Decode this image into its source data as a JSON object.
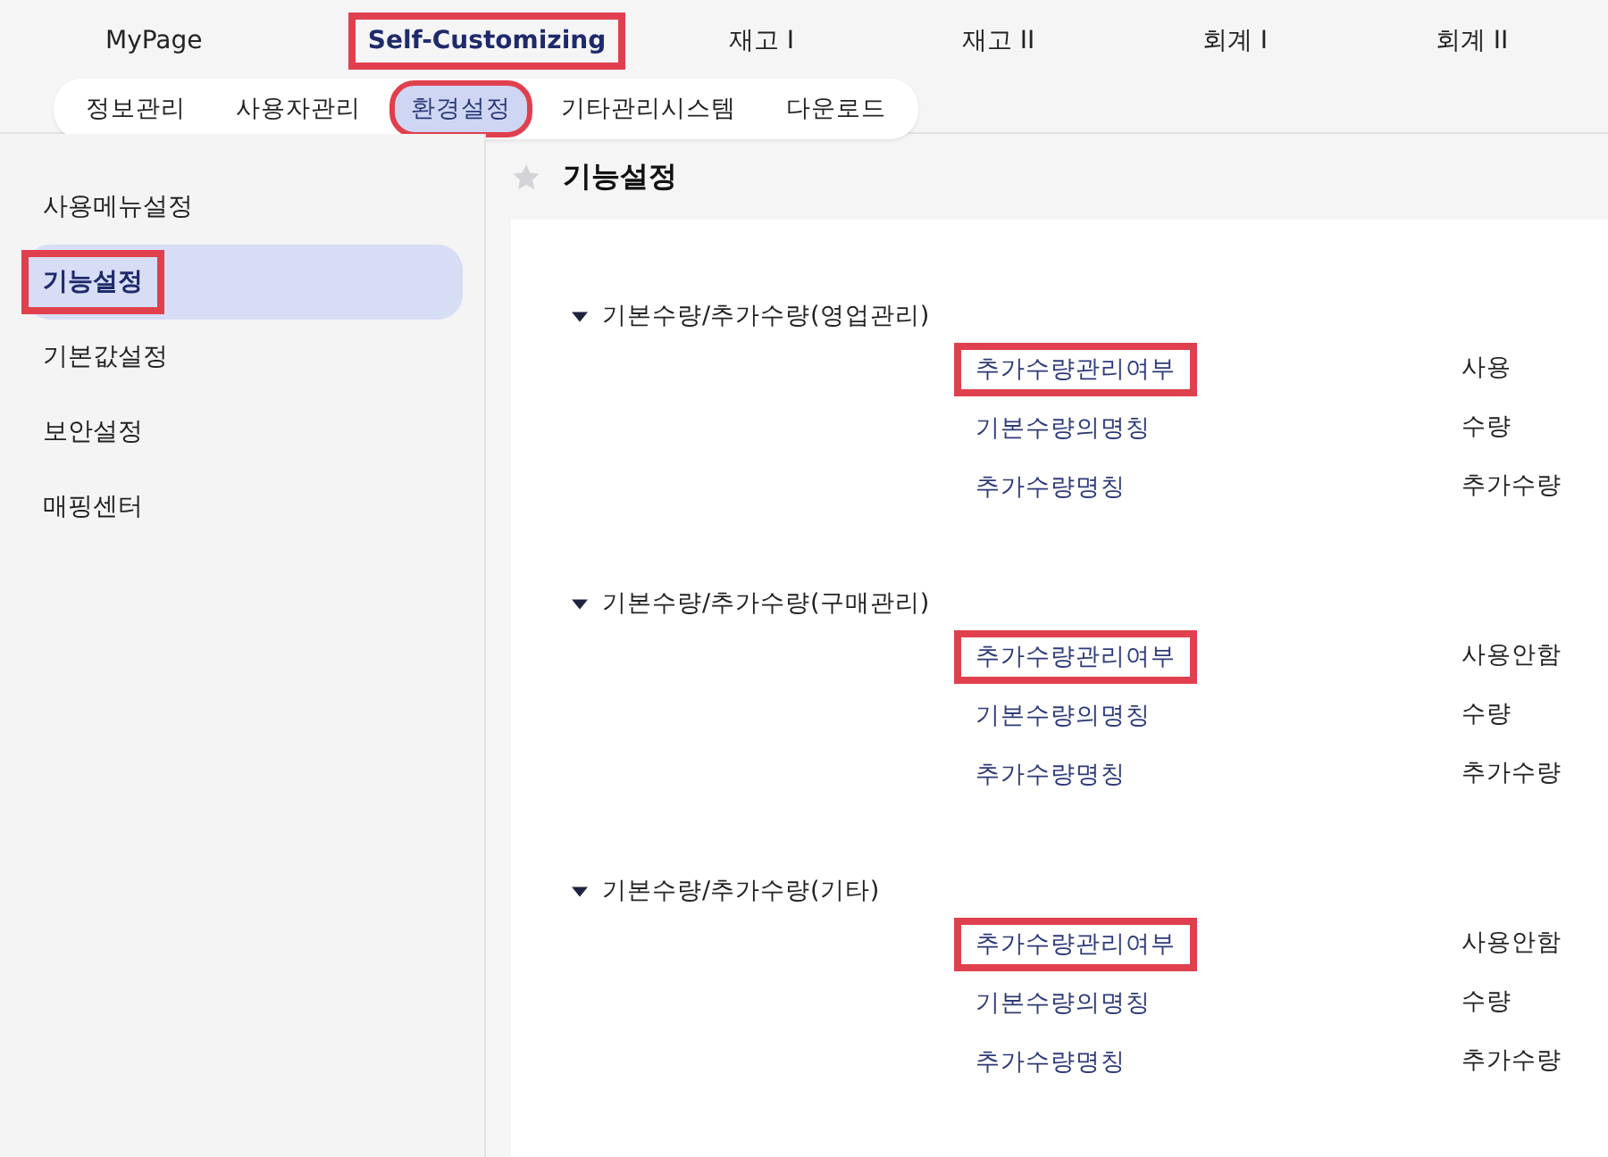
{
  "top_nav": [
    {
      "label": "MyPage",
      "selected": false,
      "highlighted": false
    },
    {
      "label": "Self-Customizing",
      "selected": true,
      "highlighted": true
    },
    {
      "label": "재고 I",
      "selected": false,
      "highlighted": false
    },
    {
      "label": "재고 II",
      "selected": false,
      "highlighted": false
    },
    {
      "label": "회계 I",
      "selected": false,
      "highlighted": false
    },
    {
      "label": "회계 II",
      "selected": false,
      "highlighted": false
    }
  ],
  "sub_tabs": [
    {
      "label": "정보관리",
      "selected": false,
      "highlighted": false
    },
    {
      "label": "사용자관리",
      "selected": false,
      "highlighted": false
    },
    {
      "label": "환경설정",
      "selected": true,
      "highlighted": true
    },
    {
      "label": "기타관리시스템",
      "selected": false,
      "highlighted": false
    },
    {
      "label": "다운로드",
      "selected": false,
      "highlighted": false
    }
  ],
  "sidebar": {
    "items": [
      {
        "label": "사용메뉴설정",
        "selected": false,
        "highlighted": false
      },
      {
        "label": "기능설정",
        "selected": true,
        "highlighted": true
      },
      {
        "label": "기본값설정",
        "selected": false,
        "highlighted": false
      },
      {
        "label": "보안설정",
        "selected": false,
        "highlighted": false
      },
      {
        "label": "매핑센터",
        "selected": false,
        "highlighted": false
      }
    ]
  },
  "page": {
    "title": "기능설정"
  },
  "groups": [
    {
      "title": "기본수량/추가수량(영업관리)",
      "expanded": true,
      "settings": [
        {
          "label": "추가수량관리여부",
          "value": "사용",
          "highlighted": true
        },
        {
          "label": "기본수량의명칭",
          "value": "수량",
          "highlighted": false
        },
        {
          "label": "추가수량명칭",
          "value": "추가수량",
          "highlighted": false
        }
      ]
    },
    {
      "title": "기본수량/추가수량(구매관리)",
      "expanded": true,
      "settings": [
        {
          "label": "추가수량관리여부",
          "value": "사용안함",
          "highlighted": true
        },
        {
          "label": "기본수량의명칭",
          "value": "수량",
          "highlighted": false
        },
        {
          "label": "추가수량명칭",
          "value": "추가수량",
          "highlighted": false
        }
      ]
    },
    {
      "title": "기본수량/추가수량(기타)",
      "expanded": true,
      "settings": [
        {
          "label": "추가수량관리여부",
          "value": "사용안함",
          "highlighted": true
        },
        {
          "label": "기본수량의명칭",
          "value": "수량",
          "highlighted": false
        },
        {
          "label": "추가수량명칭",
          "value": "추가수량",
          "highlighted": false
        }
      ]
    }
  ]
}
